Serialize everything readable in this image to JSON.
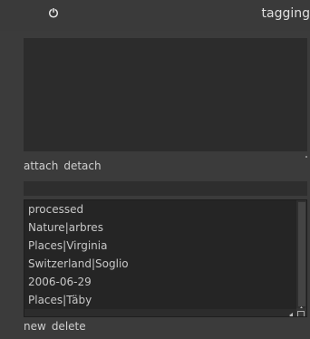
{
  "header": {
    "title": "tagging",
    "power_icon": "power-icon"
  },
  "attached": {
    "attach_label": "attach",
    "detach_label": "detach"
  },
  "entry": {
    "value": ""
  },
  "dictionary": {
    "items": [
      "processed",
      "Nature|arbres",
      "Places|Virginia",
      "Switzerland|Soglio",
      "2006-06-29",
      "Places|Täby"
    ]
  },
  "bottom": {
    "new_label": "new",
    "delete_label": "delete"
  },
  "colors": {
    "background": "#3b3b3b",
    "panel": "#2c2c2c",
    "text": "#d0d0d0"
  }
}
